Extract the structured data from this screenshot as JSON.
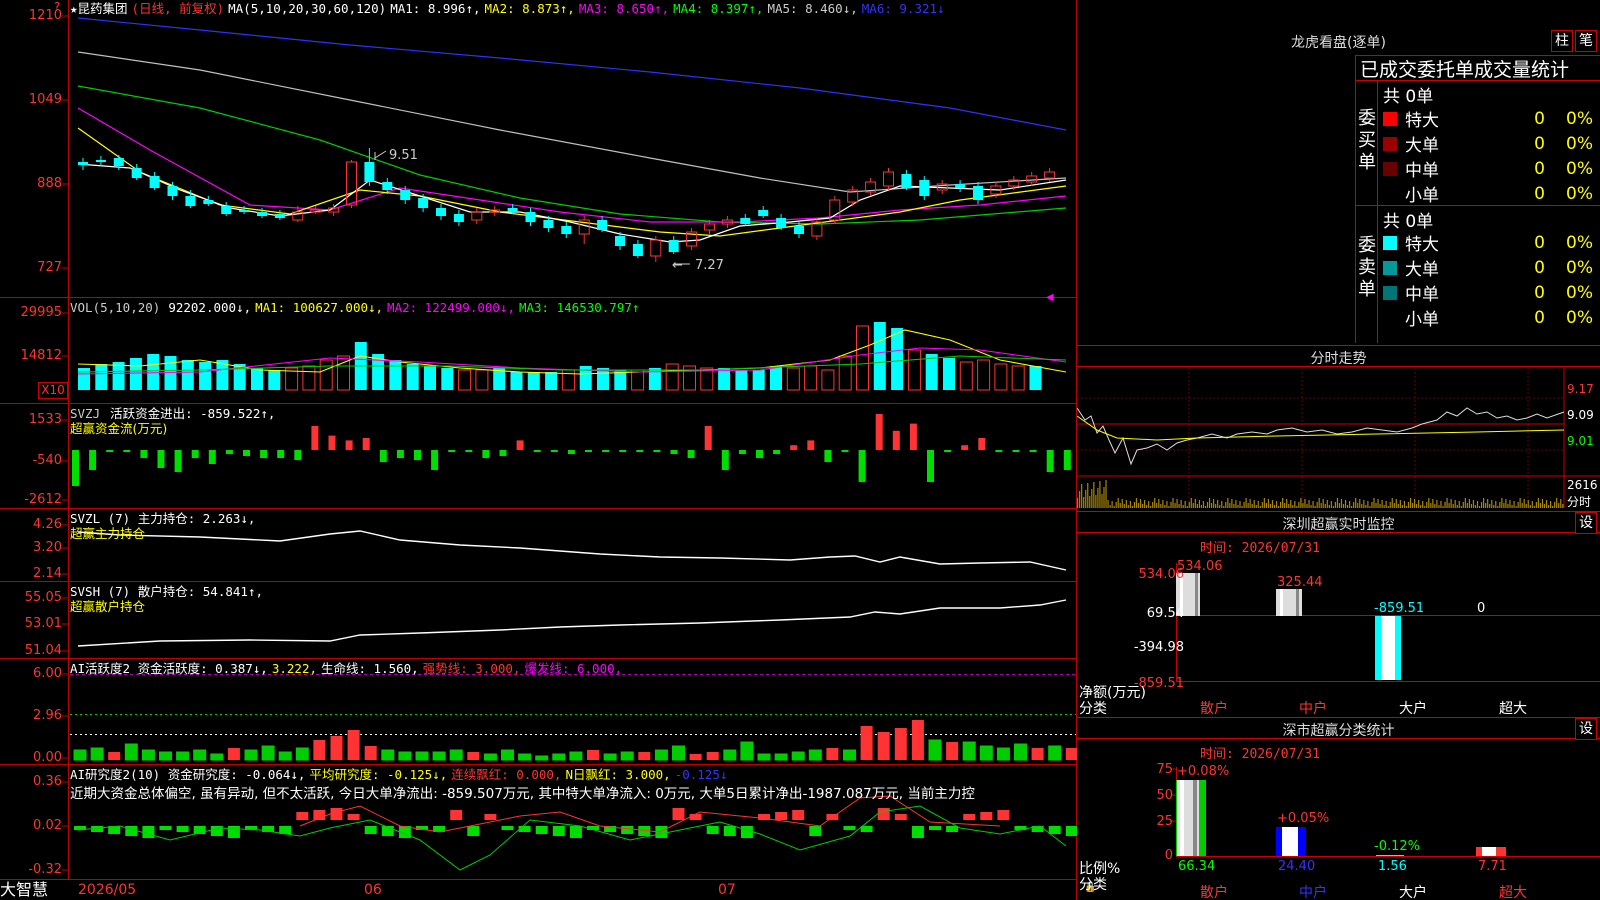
{
  "header": {
    "star": "★",
    "stock_name": "昆药集团",
    "period": "(日线, 前复权)",
    "ma_prefix": "MA(5,10,20,30,60,120)",
    "ma1": "MA1: 8.996↑,",
    "ma2": "MA2: 8.873↑,",
    "ma3": "MA3: 8.650↑,",
    "ma4": "MA4: 8.397↑,",
    "ma5": "MA5: 8.460↓,",
    "ma6": "MA6: 9.321↓"
  },
  "price_axis": [
    "1210",
    "1049",
    "888",
    "727"
  ],
  "price_annot": {
    "high": "9.51",
    "low": "7.27"
  },
  "vol": {
    "label": "VOL(5,10,20)",
    "value": "92202.000↓,",
    "ma1": "MA1: 100627.000↓,",
    "ma2": "MA2: 122499.000↓,",
    "ma3": "MA3: 146530.797↑",
    "axis": [
      "29995",
      "14812"
    ],
    "unit": "X10"
  },
  "svzj": {
    "label": "SVZJ",
    "text": "活跃资金进出: -859.522↑,",
    "sub": "超赢资金流(万元)",
    "axis": [
      "1533",
      "-540",
      "-2612"
    ]
  },
  "svzl": {
    "label": "SVZL (7) 主力持仓: 2.263↓,",
    "sub": "超赢主力持仓",
    "axis": [
      "4.26",
      "3.20",
      "2.14"
    ]
  },
  "svsh": {
    "label": "SVSH (7) 散户持仓: 54.841↑,",
    "sub": "超赢散户持仓",
    "axis": [
      "55.05",
      "53.01",
      "51.04"
    ]
  },
  "ai_active": {
    "label": "AI活跃度2 资金活跃度: 0.387↓,",
    "v2": "3.222,",
    "life": "生命线: 1.560,",
    "strong": "强势线: 3.000,",
    "burst": "爆发线: 6.000,",
    "axis": [
      "6.00",
      "2.96",
      "0.00"
    ]
  },
  "ai_research": {
    "label": "AI研究度2(10) 资金研究度: -0.064↓,",
    "avg": "平均研究度: -0.125↓,",
    "cont": "连续飘红: 0.000,",
    "nday": "N日飘红: 3.000,",
    "last": "-0.125↓",
    "comment": "近期大资金总体偏空, 虽有异动, 但不太活跃, 今日大单净流出: -859.507万元, 其中特大单净流入: 0万元, 大单5日累计净出-1987.087万元, 当前主力控",
    "axis": [
      "0.36",
      "0.02",
      "-0.32"
    ]
  },
  "date_axis": {
    "brand": "大智慧",
    "d1": "2026/05",
    "d2": "06",
    "d3": "07"
  },
  "right": {
    "dragon_title": "龙虎看盘(逐单)",
    "btn_zhu": "柱",
    "btn_bi": "笔",
    "stats_title": "已成交委托单成交量统计",
    "buy_side": "委买单",
    "sell_side": "委卖单",
    "buy_total": "共 0单",
    "sell_total": "共 0单",
    "buy_rows": [
      {
        "label": "特大",
        "count": "0",
        "pct": "0%",
        "color": "#ff0000"
      },
      {
        "label": "大单",
        "count": "0",
        "pct": "0%",
        "color": "#9b0000"
      },
      {
        "label": "中单",
        "count": "0",
        "pct": "0%",
        "color": "#6b0000"
      },
      {
        "label": "小单",
        "count": "0",
        "pct": "0%",
        "color": "#000000"
      }
    ],
    "sell_rows": [
      {
        "label": "特大",
        "count": "0",
        "pct": "0%",
        "color": "#00ffff"
      },
      {
        "label": "大单",
        "count": "0",
        "pct": "0%",
        "color": "#009a9a"
      },
      {
        "label": "中单",
        "count": "0",
        "pct": "0%",
        "color": "#007575"
      },
      {
        "label": "小单",
        "count": "0",
        "pct": "0%",
        "color": "#000000"
      }
    ],
    "intraday_title": "分时走势",
    "intraday_axis": [
      "9.17",
      "9.09",
      "9.01",
      "2616",
      "分时"
    ],
    "sz_title": "深圳超赢实时监控",
    "sz_btn": "设",
    "sz_time": "时间: 2026/07/31",
    "sz_axis": [
      "534.06",
      "69.54",
      "-394.98",
      "-859.51"
    ],
    "sz_bars": [
      {
        "label": "534.06",
        "color": "#ff3333"
      },
      {
        "label": "325.44",
        "color": "#ff3333"
      },
      {
        "label": "-859.51",
        "color": "#00ffff"
      },
      {
        "label": "0",
        "color": "#ffffff"
      }
    ],
    "sz_net": "净额(万元)",
    "sz_cat": "分类",
    "cats": [
      "散户",
      "中户",
      "大户",
      "超大"
    ],
    "cls_title": "深市超赢分类统计",
    "cls_btn": "设",
    "cls_time": "时间: 2026/07/31",
    "cls_axis": [
      "75",
      "50",
      "25",
      "0"
    ],
    "cls_top": [
      "+0.08%",
      "+0.05%",
      "-0.12%",
      ""
    ],
    "cls_bot": [
      "66.34",
      "24.40",
      "1.56",
      "7.71"
    ],
    "cls_ratio": "比例%",
    "cls_cat": "分类"
  },
  "colors": {
    "up": "#ff3333",
    "down": "#00ffff",
    "ma1": "#ffffff",
    "ma2": "#ffff00",
    "ma3": "#ff00ff",
    "ma4": "#00ff00",
    "ma5": "#c0c0c0",
    "ma6": "#3030ff"
  }
}
